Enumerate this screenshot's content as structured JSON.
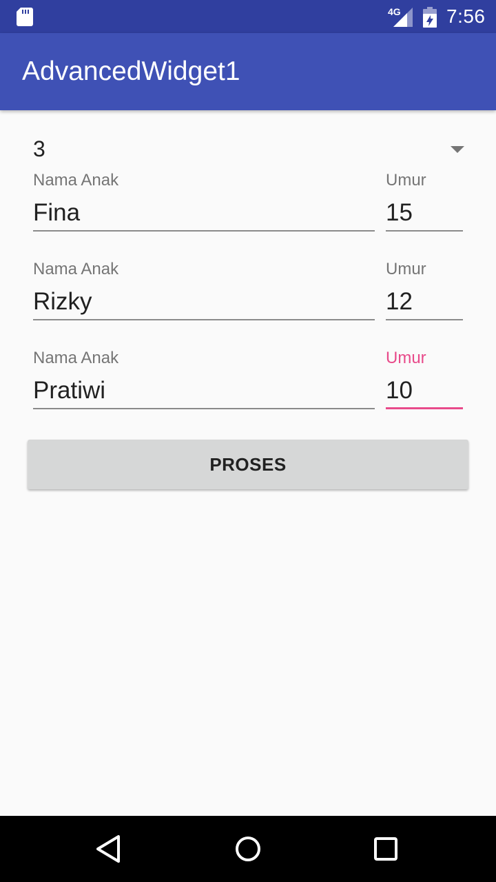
{
  "status_bar": {
    "network_label": "4G",
    "time": "7:56",
    "icons": [
      "sd-card-icon",
      "signal-icon",
      "battery-icon"
    ]
  },
  "app_bar": {
    "title": "AdvancedWidget1",
    "color": "#3f51b5"
  },
  "spinner": {
    "selected_value": "3"
  },
  "children": [
    {
      "name_label": "Nama Anak",
      "name_value": "Fina",
      "age_label": "Umur",
      "age_value": "15"
    },
    {
      "name_label": "Nama Anak",
      "name_value": "Rizky",
      "age_label": "Umur",
      "age_value": "12"
    },
    {
      "name_label": "Nama Anak",
      "name_value": "Pratiwi",
      "age_label": "Umur",
      "age_value": "10"
    }
  ],
  "focused_field": "children.2.age",
  "accent_color": "#e84a8a",
  "proses_button": {
    "label": "PROSES"
  },
  "nav_bar": {
    "icons": [
      "back-icon",
      "home-icon",
      "recents-icon"
    ]
  }
}
